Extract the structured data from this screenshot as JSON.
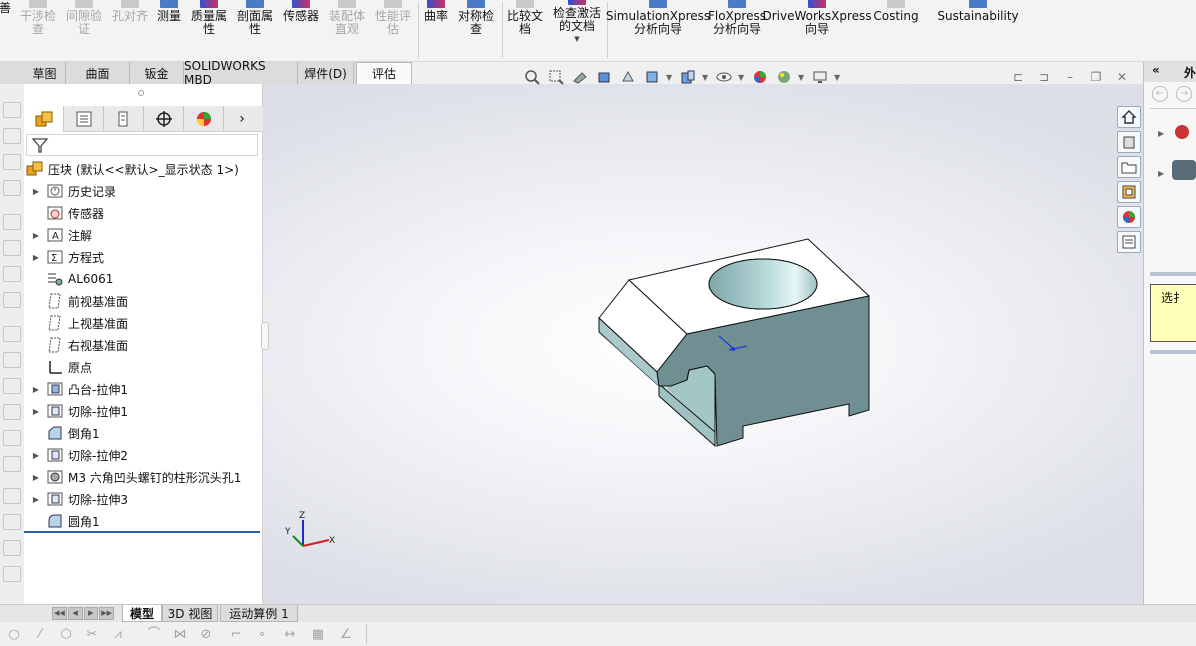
{
  "ribbon": {
    "buttons": [
      {
        "label": "干涉检\n查",
        "disabled": true
      },
      {
        "label": "间隙验\n证",
        "disabled": true
      },
      {
        "label": "孔对齐",
        "disabled": true
      },
      {
        "label": "测量",
        "disabled": false
      },
      {
        "label": "质量属\n性",
        "disabled": false
      },
      {
        "label": "剖面属\n性",
        "disabled": false
      },
      {
        "label": "传感器",
        "disabled": false
      },
      {
        "label": "装配体\n直观",
        "disabled": true
      },
      {
        "label": "性能评\n估",
        "disabled": true
      },
      {
        "label": "曲率",
        "disabled": false
      },
      {
        "label": "对称检\n查",
        "disabled": false
      },
      {
        "label": "比较文\n档",
        "disabled": false
      },
      {
        "label": "检查激活\n的文档",
        "disabled": false
      },
      {
        "label": "SimulationXpress\n分析向导",
        "disabled": false
      },
      {
        "label": "FloXpress\n分析向导",
        "disabled": false
      },
      {
        "label": "DriveWorksXpress\n向导",
        "disabled": false
      },
      {
        "label": "Costing",
        "disabled": false
      },
      {
        "label": "Sustainability",
        "disabled": false
      }
    ],
    "left_cut_label": "善"
  },
  "command_tabs": [
    {
      "label": "草图"
    },
    {
      "label": "曲面"
    },
    {
      "label": "钣金"
    },
    {
      "label": "SOLIDWORKS MBD"
    },
    {
      "label": "焊件(D)"
    },
    {
      "label": "评估",
      "active": true
    }
  ],
  "feature_tree": {
    "root": "压块  (默认<<默认>_显示状态 1>)",
    "items": [
      {
        "label": "历史记录",
        "expandable": true,
        "icon": "history-icon"
      },
      {
        "label": "传感器",
        "expandable": false,
        "icon": "sensor-icon"
      },
      {
        "label": "注解",
        "expandable": true,
        "icon": "annotation-icon"
      },
      {
        "label": "方程式",
        "expandable": true,
        "icon": "equation-icon"
      },
      {
        "label": "AL6061",
        "expandable": false,
        "icon": "material-icon"
      },
      {
        "label": "前视基准面",
        "expandable": false,
        "icon": "plane-icon"
      },
      {
        "label": "上视基准面",
        "expandable": false,
        "icon": "plane-icon"
      },
      {
        "label": "右视基准面",
        "expandable": false,
        "icon": "plane-icon"
      },
      {
        "label": "原点",
        "expandable": false,
        "icon": "origin-icon"
      },
      {
        "label": "凸台-拉伸1",
        "expandable": true,
        "icon": "boss-extrude-icon"
      },
      {
        "label": "切除-拉伸1",
        "expandable": true,
        "icon": "cut-extrude-icon"
      },
      {
        "label": "倒角1",
        "expandable": false,
        "icon": "chamfer-icon"
      },
      {
        "label": "切除-拉伸2",
        "expandable": true,
        "icon": "cut-extrude-icon"
      },
      {
        "label": "M3 六角凹头螺钉的柱形沉头孔1",
        "expandable": true,
        "icon": "hole-wizard-icon"
      },
      {
        "label": "切除-拉伸3",
        "expandable": true,
        "icon": "cut-extrude-icon"
      },
      {
        "label": "圆角1",
        "expandable": false,
        "icon": "fillet-icon"
      }
    ]
  },
  "bottom_tabs": [
    {
      "label": "模型",
      "active": true
    },
    {
      "label": "3D 视图"
    },
    {
      "label": "运动算例 1"
    }
  ],
  "task_pane": {
    "header_glyph": "«",
    "header_cut_label": "外",
    "tooltip_cut_label": "选扌"
  },
  "triad": {
    "x": "X",
    "y": "Y",
    "z": "Z"
  },
  "colors": {
    "part_face_top": "#ffffff",
    "part_face_front": "#6f8f92",
    "part_face_side": "#9ec3c4",
    "rollback_bar": "#2a5fb8"
  }
}
